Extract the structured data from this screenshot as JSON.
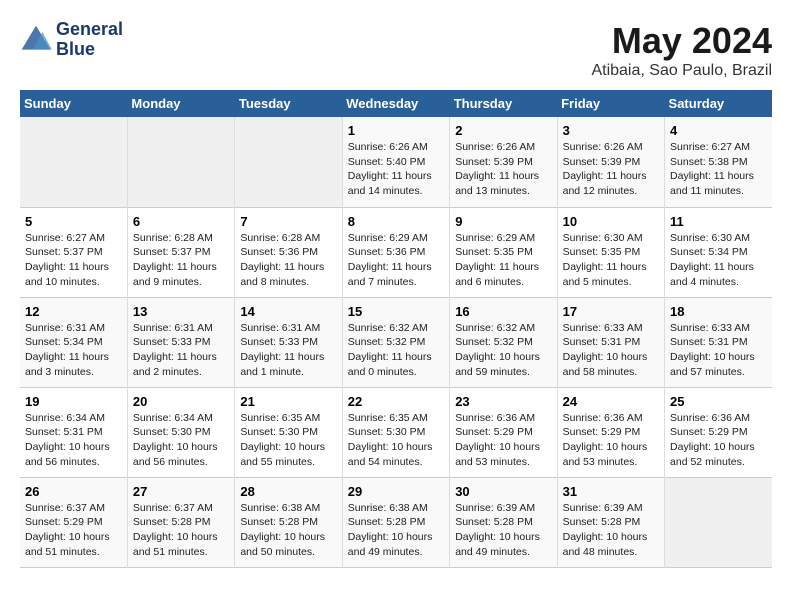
{
  "header": {
    "logo_line1": "General",
    "logo_line2": "Blue",
    "month": "May 2024",
    "location": "Atibaia, Sao Paulo, Brazil"
  },
  "days_of_week": [
    "Sunday",
    "Monday",
    "Tuesday",
    "Wednesday",
    "Thursday",
    "Friday",
    "Saturday"
  ],
  "weeks": [
    [
      {
        "day": "",
        "content": ""
      },
      {
        "day": "",
        "content": ""
      },
      {
        "day": "",
        "content": ""
      },
      {
        "day": "1",
        "content": "Sunrise: 6:26 AM\nSunset: 5:40 PM\nDaylight: 11 hours\nand 14 minutes."
      },
      {
        "day": "2",
        "content": "Sunrise: 6:26 AM\nSunset: 5:39 PM\nDaylight: 11 hours\nand 13 minutes."
      },
      {
        "day": "3",
        "content": "Sunrise: 6:26 AM\nSunset: 5:39 PM\nDaylight: 11 hours\nand 12 minutes."
      },
      {
        "day": "4",
        "content": "Sunrise: 6:27 AM\nSunset: 5:38 PM\nDaylight: 11 hours\nand 11 minutes."
      }
    ],
    [
      {
        "day": "5",
        "content": "Sunrise: 6:27 AM\nSunset: 5:37 PM\nDaylight: 11 hours\nand 10 minutes."
      },
      {
        "day": "6",
        "content": "Sunrise: 6:28 AM\nSunset: 5:37 PM\nDaylight: 11 hours\nand 9 minutes."
      },
      {
        "day": "7",
        "content": "Sunrise: 6:28 AM\nSunset: 5:36 PM\nDaylight: 11 hours\nand 8 minutes."
      },
      {
        "day": "8",
        "content": "Sunrise: 6:29 AM\nSunset: 5:36 PM\nDaylight: 11 hours\nand 7 minutes."
      },
      {
        "day": "9",
        "content": "Sunrise: 6:29 AM\nSunset: 5:35 PM\nDaylight: 11 hours\nand 6 minutes."
      },
      {
        "day": "10",
        "content": "Sunrise: 6:30 AM\nSunset: 5:35 PM\nDaylight: 11 hours\nand 5 minutes."
      },
      {
        "day": "11",
        "content": "Sunrise: 6:30 AM\nSunset: 5:34 PM\nDaylight: 11 hours\nand 4 minutes."
      }
    ],
    [
      {
        "day": "12",
        "content": "Sunrise: 6:31 AM\nSunset: 5:34 PM\nDaylight: 11 hours\nand 3 minutes."
      },
      {
        "day": "13",
        "content": "Sunrise: 6:31 AM\nSunset: 5:33 PM\nDaylight: 11 hours\nand 2 minutes."
      },
      {
        "day": "14",
        "content": "Sunrise: 6:31 AM\nSunset: 5:33 PM\nDaylight: 11 hours\nand 1 minute."
      },
      {
        "day": "15",
        "content": "Sunrise: 6:32 AM\nSunset: 5:32 PM\nDaylight: 11 hours\nand 0 minutes."
      },
      {
        "day": "16",
        "content": "Sunrise: 6:32 AM\nSunset: 5:32 PM\nDaylight: 10 hours\nand 59 minutes."
      },
      {
        "day": "17",
        "content": "Sunrise: 6:33 AM\nSunset: 5:31 PM\nDaylight: 10 hours\nand 58 minutes."
      },
      {
        "day": "18",
        "content": "Sunrise: 6:33 AM\nSunset: 5:31 PM\nDaylight: 10 hours\nand 57 minutes."
      }
    ],
    [
      {
        "day": "19",
        "content": "Sunrise: 6:34 AM\nSunset: 5:31 PM\nDaylight: 10 hours\nand 56 minutes."
      },
      {
        "day": "20",
        "content": "Sunrise: 6:34 AM\nSunset: 5:30 PM\nDaylight: 10 hours\nand 56 minutes."
      },
      {
        "day": "21",
        "content": "Sunrise: 6:35 AM\nSunset: 5:30 PM\nDaylight: 10 hours\nand 55 minutes."
      },
      {
        "day": "22",
        "content": "Sunrise: 6:35 AM\nSunset: 5:30 PM\nDaylight: 10 hours\nand 54 minutes."
      },
      {
        "day": "23",
        "content": "Sunrise: 6:36 AM\nSunset: 5:29 PM\nDaylight: 10 hours\nand 53 minutes."
      },
      {
        "day": "24",
        "content": "Sunrise: 6:36 AM\nSunset: 5:29 PM\nDaylight: 10 hours\nand 53 minutes."
      },
      {
        "day": "25",
        "content": "Sunrise: 6:36 AM\nSunset: 5:29 PM\nDaylight: 10 hours\nand 52 minutes."
      }
    ],
    [
      {
        "day": "26",
        "content": "Sunrise: 6:37 AM\nSunset: 5:29 PM\nDaylight: 10 hours\nand 51 minutes."
      },
      {
        "day": "27",
        "content": "Sunrise: 6:37 AM\nSunset: 5:28 PM\nDaylight: 10 hours\nand 51 minutes."
      },
      {
        "day": "28",
        "content": "Sunrise: 6:38 AM\nSunset: 5:28 PM\nDaylight: 10 hours\nand 50 minutes."
      },
      {
        "day": "29",
        "content": "Sunrise: 6:38 AM\nSunset: 5:28 PM\nDaylight: 10 hours\nand 49 minutes."
      },
      {
        "day": "30",
        "content": "Sunrise: 6:39 AM\nSunset: 5:28 PM\nDaylight: 10 hours\nand 49 minutes."
      },
      {
        "day": "31",
        "content": "Sunrise: 6:39 AM\nSunset: 5:28 PM\nDaylight: 10 hours\nand 48 minutes."
      },
      {
        "day": "",
        "content": ""
      }
    ]
  ]
}
